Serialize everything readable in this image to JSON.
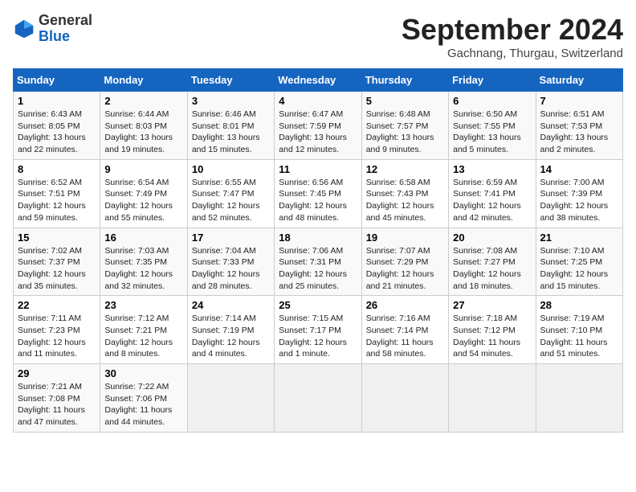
{
  "header": {
    "logo_line1": "General",
    "logo_line2": "Blue",
    "month_title": "September 2024",
    "location": "Gachnang, Thurgau, Switzerland"
  },
  "weekdays": [
    "Sunday",
    "Monday",
    "Tuesday",
    "Wednesday",
    "Thursday",
    "Friday",
    "Saturday"
  ],
  "weeks": [
    [
      {
        "day": "1",
        "info": "Sunrise: 6:43 AM\nSunset: 8:05 PM\nDaylight: 13 hours\nand 22 minutes."
      },
      {
        "day": "2",
        "info": "Sunrise: 6:44 AM\nSunset: 8:03 PM\nDaylight: 13 hours\nand 19 minutes."
      },
      {
        "day": "3",
        "info": "Sunrise: 6:46 AM\nSunset: 8:01 PM\nDaylight: 13 hours\nand 15 minutes."
      },
      {
        "day": "4",
        "info": "Sunrise: 6:47 AM\nSunset: 7:59 PM\nDaylight: 13 hours\nand 12 minutes."
      },
      {
        "day": "5",
        "info": "Sunrise: 6:48 AM\nSunset: 7:57 PM\nDaylight: 13 hours\nand 9 minutes."
      },
      {
        "day": "6",
        "info": "Sunrise: 6:50 AM\nSunset: 7:55 PM\nDaylight: 13 hours\nand 5 minutes."
      },
      {
        "day": "7",
        "info": "Sunrise: 6:51 AM\nSunset: 7:53 PM\nDaylight: 13 hours\nand 2 minutes."
      }
    ],
    [
      {
        "day": "8",
        "info": "Sunrise: 6:52 AM\nSunset: 7:51 PM\nDaylight: 12 hours\nand 59 minutes."
      },
      {
        "day": "9",
        "info": "Sunrise: 6:54 AM\nSunset: 7:49 PM\nDaylight: 12 hours\nand 55 minutes."
      },
      {
        "day": "10",
        "info": "Sunrise: 6:55 AM\nSunset: 7:47 PM\nDaylight: 12 hours\nand 52 minutes."
      },
      {
        "day": "11",
        "info": "Sunrise: 6:56 AM\nSunset: 7:45 PM\nDaylight: 12 hours\nand 48 minutes."
      },
      {
        "day": "12",
        "info": "Sunrise: 6:58 AM\nSunset: 7:43 PM\nDaylight: 12 hours\nand 45 minutes."
      },
      {
        "day": "13",
        "info": "Sunrise: 6:59 AM\nSunset: 7:41 PM\nDaylight: 12 hours\nand 42 minutes."
      },
      {
        "day": "14",
        "info": "Sunrise: 7:00 AM\nSunset: 7:39 PM\nDaylight: 12 hours\nand 38 minutes."
      }
    ],
    [
      {
        "day": "15",
        "info": "Sunrise: 7:02 AM\nSunset: 7:37 PM\nDaylight: 12 hours\nand 35 minutes."
      },
      {
        "day": "16",
        "info": "Sunrise: 7:03 AM\nSunset: 7:35 PM\nDaylight: 12 hours\nand 32 minutes."
      },
      {
        "day": "17",
        "info": "Sunrise: 7:04 AM\nSunset: 7:33 PM\nDaylight: 12 hours\nand 28 minutes."
      },
      {
        "day": "18",
        "info": "Sunrise: 7:06 AM\nSunset: 7:31 PM\nDaylight: 12 hours\nand 25 minutes."
      },
      {
        "day": "19",
        "info": "Sunrise: 7:07 AM\nSunset: 7:29 PM\nDaylight: 12 hours\nand 21 minutes."
      },
      {
        "day": "20",
        "info": "Sunrise: 7:08 AM\nSunset: 7:27 PM\nDaylight: 12 hours\nand 18 minutes."
      },
      {
        "day": "21",
        "info": "Sunrise: 7:10 AM\nSunset: 7:25 PM\nDaylight: 12 hours\nand 15 minutes."
      }
    ],
    [
      {
        "day": "22",
        "info": "Sunrise: 7:11 AM\nSunset: 7:23 PM\nDaylight: 12 hours\nand 11 minutes."
      },
      {
        "day": "23",
        "info": "Sunrise: 7:12 AM\nSunset: 7:21 PM\nDaylight: 12 hours\nand 8 minutes."
      },
      {
        "day": "24",
        "info": "Sunrise: 7:14 AM\nSunset: 7:19 PM\nDaylight: 12 hours\nand 4 minutes."
      },
      {
        "day": "25",
        "info": "Sunrise: 7:15 AM\nSunset: 7:17 PM\nDaylight: 12 hours\nand 1 minute."
      },
      {
        "day": "26",
        "info": "Sunrise: 7:16 AM\nSunset: 7:14 PM\nDaylight: 11 hours\nand 58 minutes."
      },
      {
        "day": "27",
        "info": "Sunrise: 7:18 AM\nSunset: 7:12 PM\nDaylight: 11 hours\nand 54 minutes."
      },
      {
        "day": "28",
        "info": "Sunrise: 7:19 AM\nSunset: 7:10 PM\nDaylight: 11 hours\nand 51 minutes."
      }
    ],
    [
      {
        "day": "29",
        "info": "Sunrise: 7:21 AM\nSunset: 7:08 PM\nDaylight: 11 hours\nand 47 minutes."
      },
      {
        "day": "30",
        "info": "Sunrise: 7:22 AM\nSunset: 7:06 PM\nDaylight: 11 hours\nand 44 minutes."
      },
      {
        "day": "",
        "info": ""
      },
      {
        "day": "",
        "info": ""
      },
      {
        "day": "",
        "info": ""
      },
      {
        "day": "",
        "info": ""
      },
      {
        "day": "",
        "info": ""
      }
    ]
  ]
}
